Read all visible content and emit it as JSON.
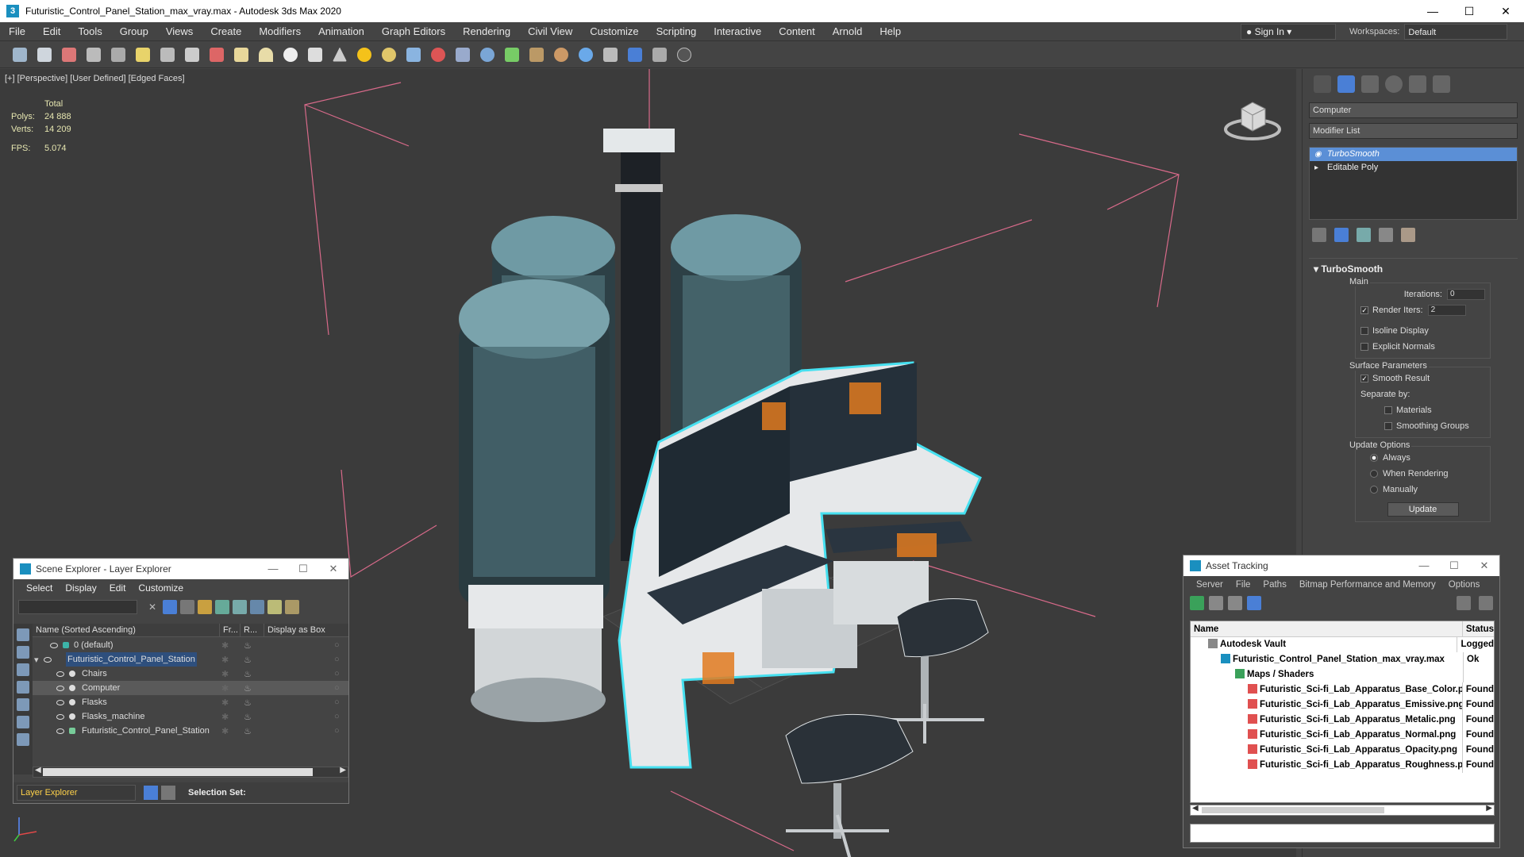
{
  "window": {
    "title": "Futuristic_Control_Panel_Station_max_vray.max - Autodesk 3ds Max 2020",
    "app_icon_letter": "3"
  },
  "menu": [
    "File",
    "Edit",
    "Tools",
    "Group",
    "Views",
    "Create",
    "Modifiers",
    "Animation",
    "Graph Editors",
    "Rendering",
    "Civil View",
    "Customize",
    "Scripting",
    "Interactive",
    "Content",
    "Arnold",
    "Help"
  ],
  "account": {
    "sign_in": "Sign In"
  },
  "workspaces": {
    "label": "Workspaces:",
    "value": "Default"
  },
  "viewport": {
    "label": "[+] [Perspective] [User Defined] [Edged Faces]",
    "stats": {
      "total_label": "Total",
      "polys_label": "Polys:",
      "polys": "24 888",
      "verts_label": "Verts:",
      "verts": "14 209",
      "fps_label": "FPS:",
      "fps": "5.074"
    }
  },
  "command_panel": {
    "object_name": "Computer",
    "modifier_list": "Modifier List",
    "stack": [
      {
        "label": "TurboSmooth",
        "selected": true
      },
      {
        "label": "Editable Poly",
        "selected": false
      }
    ],
    "rollout_title": "TurboSmooth",
    "main_group": "Main",
    "iterations_label": "Iterations:",
    "iterations": "0",
    "render_iters_label": "Render Iters:",
    "render_iters": "2",
    "isoline_display": "Isoline Display",
    "explicit_normals": "Explicit Normals",
    "surface_params": "Surface Parameters",
    "smooth_result": "Smooth Result",
    "separate_by": "Separate by:",
    "materials": "Materials",
    "smoothing_groups": "Smoothing Groups",
    "update_options": "Update Options",
    "always": "Always",
    "when_rendering": "When Rendering",
    "manually": "Manually",
    "update_button": "Update"
  },
  "scene_explorer": {
    "title": "Scene Explorer - Layer Explorer",
    "menu": [
      "Select",
      "Display",
      "Edit",
      "Customize"
    ],
    "columns": [
      "Name (Sorted Ascending)",
      "Fr...",
      "R...",
      "Display as Box"
    ],
    "rows": [
      {
        "name": "0 (default)",
        "indent": 0
      },
      {
        "name": "Futuristic_Control_Panel_Station",
        "indent": 0
      },
      {
        "name": "Chairs",
        "indent": 1
      },
      {
        "name": "Computer",
        "indent": 1
      },
      {
        "name": "Flasks",
        "indent": 1
      },
      {
        "name": "Flasks_machine",
        "indent": 1
      },
      {
        "name": "Futuristic_Control_Panel_Station",
        "indent": 1
      }
    ],
    "layer_explorer": "Layer Explorer",
    "selection_set": "Selection Set:"
  },
  "asset_tracking": {
    "title": "Asset Tracking",
    "menu": [
      "Server",
      "File",
      "Paths",
      "Bitmap Performance and Memory",
      "Options"
    ],
    "columns": [
      "Name",
      "Status"
    ],
    "rows": [
      {
        "name": "Autodesk Vault",
        "status": "Logged",
        "indent": 1
      },
      {
        "name": "Futuristic_Control_Panel_Station_max_vray.max",
        "status": "Ok",
        "indent": 2
      },
      {
        "name": "Maps / Shaders",
        "status": "",
        "indent": 3
      },
      {
        "name": "Futuristic_Sci-fi_Lab_Apparatus_Base_Color.png",
        "status": "Found",
        "indent": 4
      },
      {
        "name": "Futuristic_Sci-fi_Lab_Apparatus_Emissive.png",
        "status": "Found",
        "indent": 4
      },
      {
        "name": "Futuristic_Sci-fi_Lab_Apparatus_Metalic.png",
        "status": "Found",
        "indent": 4
      },
      {
        "name": "Futuristic_Sci-fi_Lab_Apparatus_Normal.png",
        "status": "Found",
        "indent": 4
      },
      {
        "name": "Futuristic_Sci-fi_Lab_Apparatus_Opacity.png",
        "status": "Found",
        "indent": 4
      },
      {
        "name": "Futuristic_Sci-fi_Lab_Apparatus_Roughness.png",
        "status": "Found",
        "indent": 4
      }
    ]
  }
}
